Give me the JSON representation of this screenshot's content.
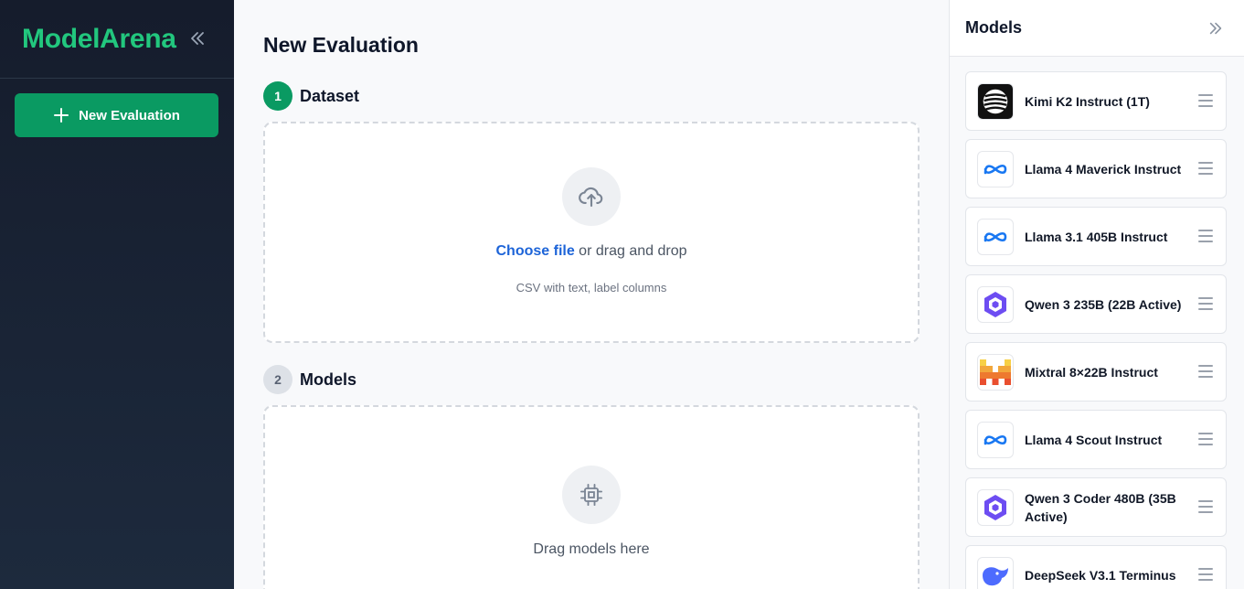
{
  "sidebar": {
    "brand": "ModelArena",
    "new_eval_label": "New Evaluation"
  },
  "main": {
    "title": "New Evaluation",
    "steps": [
      {
        "number": "1",
        "label": "Dataset"
      },
      {
        "number": "2",
        "label": "Models"
      }
    ],
    "dataset_zone": {
      "link_text": "Choose file",
      "text": " or drag and drop",
      "subtext": "CSV with text, label columns"
    },
    "models_zone": {
      "text": "Drag models here"
    }
  },
  "models_panel": {
    "title": "Models",
    "items": [
      {
        "name": "Kimi K2 Instruct (1T)",
        "logo": "kimi-logo"
      },
      {
        "name": "Llama 4 Maverick Instruct",
        "logo": "meta-logo"
      },
      {
        "name": "Llama 3.1 405B Instruct",
        "logo": "meta-logo"
      },
      {
        "name": "Qwen 3 235B (22B Active)",
        "logo": "qwen-logo"
      },
      {
        "name": "Mixtral 8×22B Instruct",
        "logo": "mistral-logo"
      },
      {
        "name": "Llama 4 Scout Instruct",
        "logo": "meta-logo"
      },
      {
        "name": "Qwen 3 Coder 480B (35B Active)",
        "logo": "qwen-logo"
      },
      {
        "name": "DeepSeek V3.1 Terminus",
        "logo": "deepseek-logo"
      }
    ]
  },
  "colors": {
    "accent": "#0a9a62",
    "brand_text": "#22c77e",
    "link": "#1d64d8",
    "sidebar_bg": "#151c2c"
  }
}
